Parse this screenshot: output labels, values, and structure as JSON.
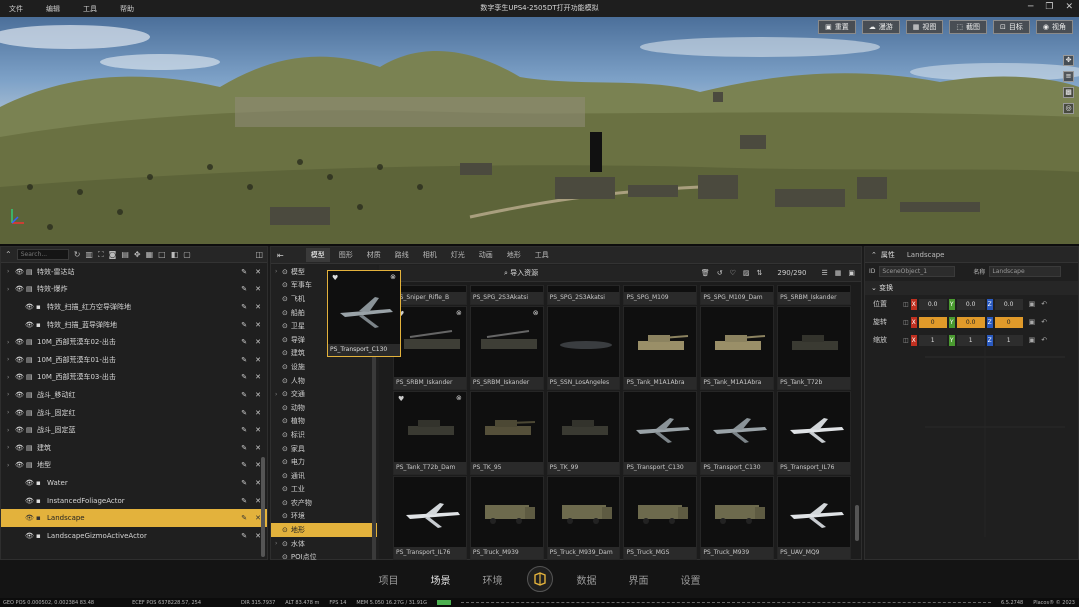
{
  "menu": [
    "文件",
    "编辑",
    "工具",
    "帮助"
  ],
  "window_title": "数字孪生UPS4-2505DT打开功能模拟",
  "viewport": {
    "buttons": [
      {
        "icon": "camera-icon",
        "label": "重置"
      },
      {
        "icon": "cloud-icon",
        "label": "漫游"
      },
      {
        "icon": "grid-icon",
        "label": "视图"
      },
      {
        "icon": "screenshot-icon",
        "label": "截图"
      },
      {
        "icon": "marker-icon",
        "label": "目标"
      },
      {
        "icon": "eye-icon",
        "label": "视角"
      }
    ]
  },
  "outliner": {
    "search_placeholder": "Search...",
    "rows": [
      {
        "label": "特效-雷达站",
        "indent": 0,
        "arrow": true
      },
      {
        "label": "特效-爆炸",
        "indent": 0,
        "arrow": true
      },
      {
        "label": "特效_扫描_红方空导弹阵地",
        "indent": 1,
        "arrow": false
      },
      {
        "label": "特效_扫描_蓝导弹阵地",
        "indent": 1,
        "arrow": false
      },
      {
        "label": "10M_西部荒漠车02-出击",
        "indent": 0,
        "arrow": true
      },
      {
        "label": "10M_西部荒漠车01-出击",
        "indent": 0,
        "arrow": true
      },
      {
        "label": "10M_西部荒漠车03-出击",
        "indent": 0,
        "arrow": true
      },
      {
        "label": "战斗_移动红",
        "indent": 0,
        "arrow": true
      },
      {
        "label": "战斗_固定红",
        "indent": 0,
        "arrow": true
      },
      {
        "label": "战斗_固定蓝",
        "indent": 0,
        "arrow": true
      },
      {
        "label": "建筑",
        "indent": 0,
        "arrow": true
      },
      {
        "label": "地型",
        "indent": 0,
        "arrow": true
      },
      {
        "label": "Water",
        "indent": 1,
        "arrow": false
      },
      {
        "label": "InstancedFoliageActor",
        "indent": 1,
        "arrow": false
      },
      {
        "label": "Landscape",
        "indent": 1,
        "arrow": false,
        "selected": true
      },
      {
        "label": "LandscapeGizmoActiveActor",
        "indent": 1,
        "arrow": false
      }
    ]
  },
  "content": {
    "tabs": [
      "模型",
      "图形",
      "材质",
      "路线",
      "相机",
      "灯光",
      "动画",
      "地形",
      "工具"
    ],
    "active_tab": 0,
    "categories": [
      {
        "label": "模型",
        "arrow": true
      },
      {
        "label": "军事车",
        "arrow": false
      },
      {
        "label": "飞机",
        "arrow": false
      },
      {
        "label": "船舶",
        "arrow": false
      },
      {
        "label": "卫星",
        "arrow": false
      },
      {
        "label": "导弹",
        "arrow": false
      },
      {
        "label": "建筑",
        "arrow": false
      },
      {
        "label": "设施",
        "arrow": false
      },
      {
        "label": "人物",
        "arrow": false
      },
      {
        "label": "交通",
        "arrow": true
      },
      {
        "label": "动物",
        "arrow": false
      },
      {
        "label": "植物",
        "arrow": false
      },
      {
        "label": "标识",
        "arrow": false
      },
      {
        "label": "家具",
        "arrow": false
      },
      {
        "label": "电力",
        "arrow": false
      },
      {
        "label": "通讯",
        "arrow": false
      },
      {
        "label": "工业",
        "arrow": false
      },
      {
        "label": "农产物",
        "arrow": false
      },
      {
        "label": "环境",
        "arrow": false
      },
      {
        "label": "地形",
        "arrow": false,
        "selected": true
      },
      {
        "label": "水体",
        "arrow": true
      },
      {
        "label": "POI点位",
        "arrow": false
      }
    ],
    "import_label": "导入资源",
    "count": "290/290",
    "preview_caption": "PS_Transport_C130",
    "tiles_top": [
      "PS_Sniper_Rifle_B",
      "PS_SPG_2S3Akatsi",
      "PS_SPG_2S3Akatsi",
      "PS_SPG_M109",
      "PS_SPG_M109_Dam",
      "PS_SRBM_Iskander"
    ],
    "tiles": [
      [
        "",
        "PS_SRBM_Iskander",
        "PS_SRBM_Iskander",
        "PS_SSN_LosAngeles",
        "PS_Tank_M1A1Abra",
        "PS_Tank_M1A1Abra",
        "PS_Tank_T72b"
      ],
      [
        "PS_Tank_T72b_Dam",
        "PS_TK_95",
        "PS_TK_99",
        "PS_Transport_C130",
        "PS_Transport_C130",
        "PS_Transport_IL76"
      ],
      [
        "PS_Transport_IL76",
        "PS_Truck_M939",
        "PS_Truck_M939_Dam",
        "PS_Truck_MGS",
        "PS_Truck_M939",
        "PS_UAV_MQ9"
      ]
    ]
  },
  "properties": {
    "header": "属性",
    "object": "Landscape",
    "id_label": "ID",
    "id_value": "SceneObject_1",
    "name_label": "名称",
    "name_value": "Landscape",
    "transform_label": "变换",
    "rows": [
      {
        "label": "位置",
        "x": "0.0",
        "y": "0.0",
        "z": "0.0",
        "highlight": false
      },
      {
        "label": "旋转",
        "x": "0",
        "y": "0.0",
        "z": "0",
        "highlight": true
      },
      {
        "label": "缩放",
        "x": "1",
        "y": "1",
        "z": "1",
        "highlight": false
      }
    ]
  },
  "bottom_tabs": [
    "项目",
    "场景",
    "环境",
    "数据",
    "界面",
    "设置"
  ],
  "active_bottom": 1,
  "status": {
    "geo_pos": "GEO POS 0.000502, 0.002384 83.48",
    "ecef_pos": "ECEF POS 6378228.57, 254",
    "dir": "DIR 315.7937",
    "alt": "ALT 83.478 m",
    "fps": "FPS 14",
    "mem": "MEM 5.050 16.27G / 31.91G",
    "version": "6.5.2748",
    "copyright": "Placos® © 2023"
  },
  "colors": {
    "accent": "#e3b23c",
    "x_axis": "#c03020",
    "y_axis": "#4a9a30",
    "z_axis": "#2a5ac0"
  }
}
